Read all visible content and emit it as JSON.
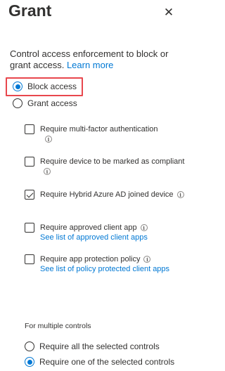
{
  "panel": {
    "title": "Grant",
    "close_glyph": "✕"
  },
  "description": {
    "text": "Control access enforcement to block or grant access. ",
    "link": "Learn more"
  },
  "access_options": [
    {
      "label": "Block access",
      "selected": true
    },
    {
      "label": "Grant access",
      "selected": false
    }
  ],
  "grant_controls": [
    {
      "label": "Require multi-factor authentication",
      "checked": false,
      "info": true
    },
    {
      "label": "Require device to be marked as compliant",
      "checked": false,
      "info": true
    },
    {
      "label": "Require Hybrid Azure AD joined device",
      "checked": true,
      "info": true
    },
    {
      "label": "Require approved client app",
      "checked": false,
      "info": true,
      "link": "See list of approved client apps"
    },
    {
      "label": "Require app protection policy",
      "checked": false,
      "info": true,
      "link": "See list of policy protected client apps"
    }
  ],
  "multiple_controls": {
    "label": "For multiple controls",
    "options": [
      {
        "label": "Require all the selected controls",
        "selected": false
      },
      {
        "label": "Require one of the selected controls",
        "selected": true
      }
    ]
  },
  "colors": {
    "accent": "#0078d4",
    "highlight": "#e8474d",
    "text": "#323130"
  },
  "icons": {
    "close": "close-icon",
    "info": "info-icon"
  }
}
